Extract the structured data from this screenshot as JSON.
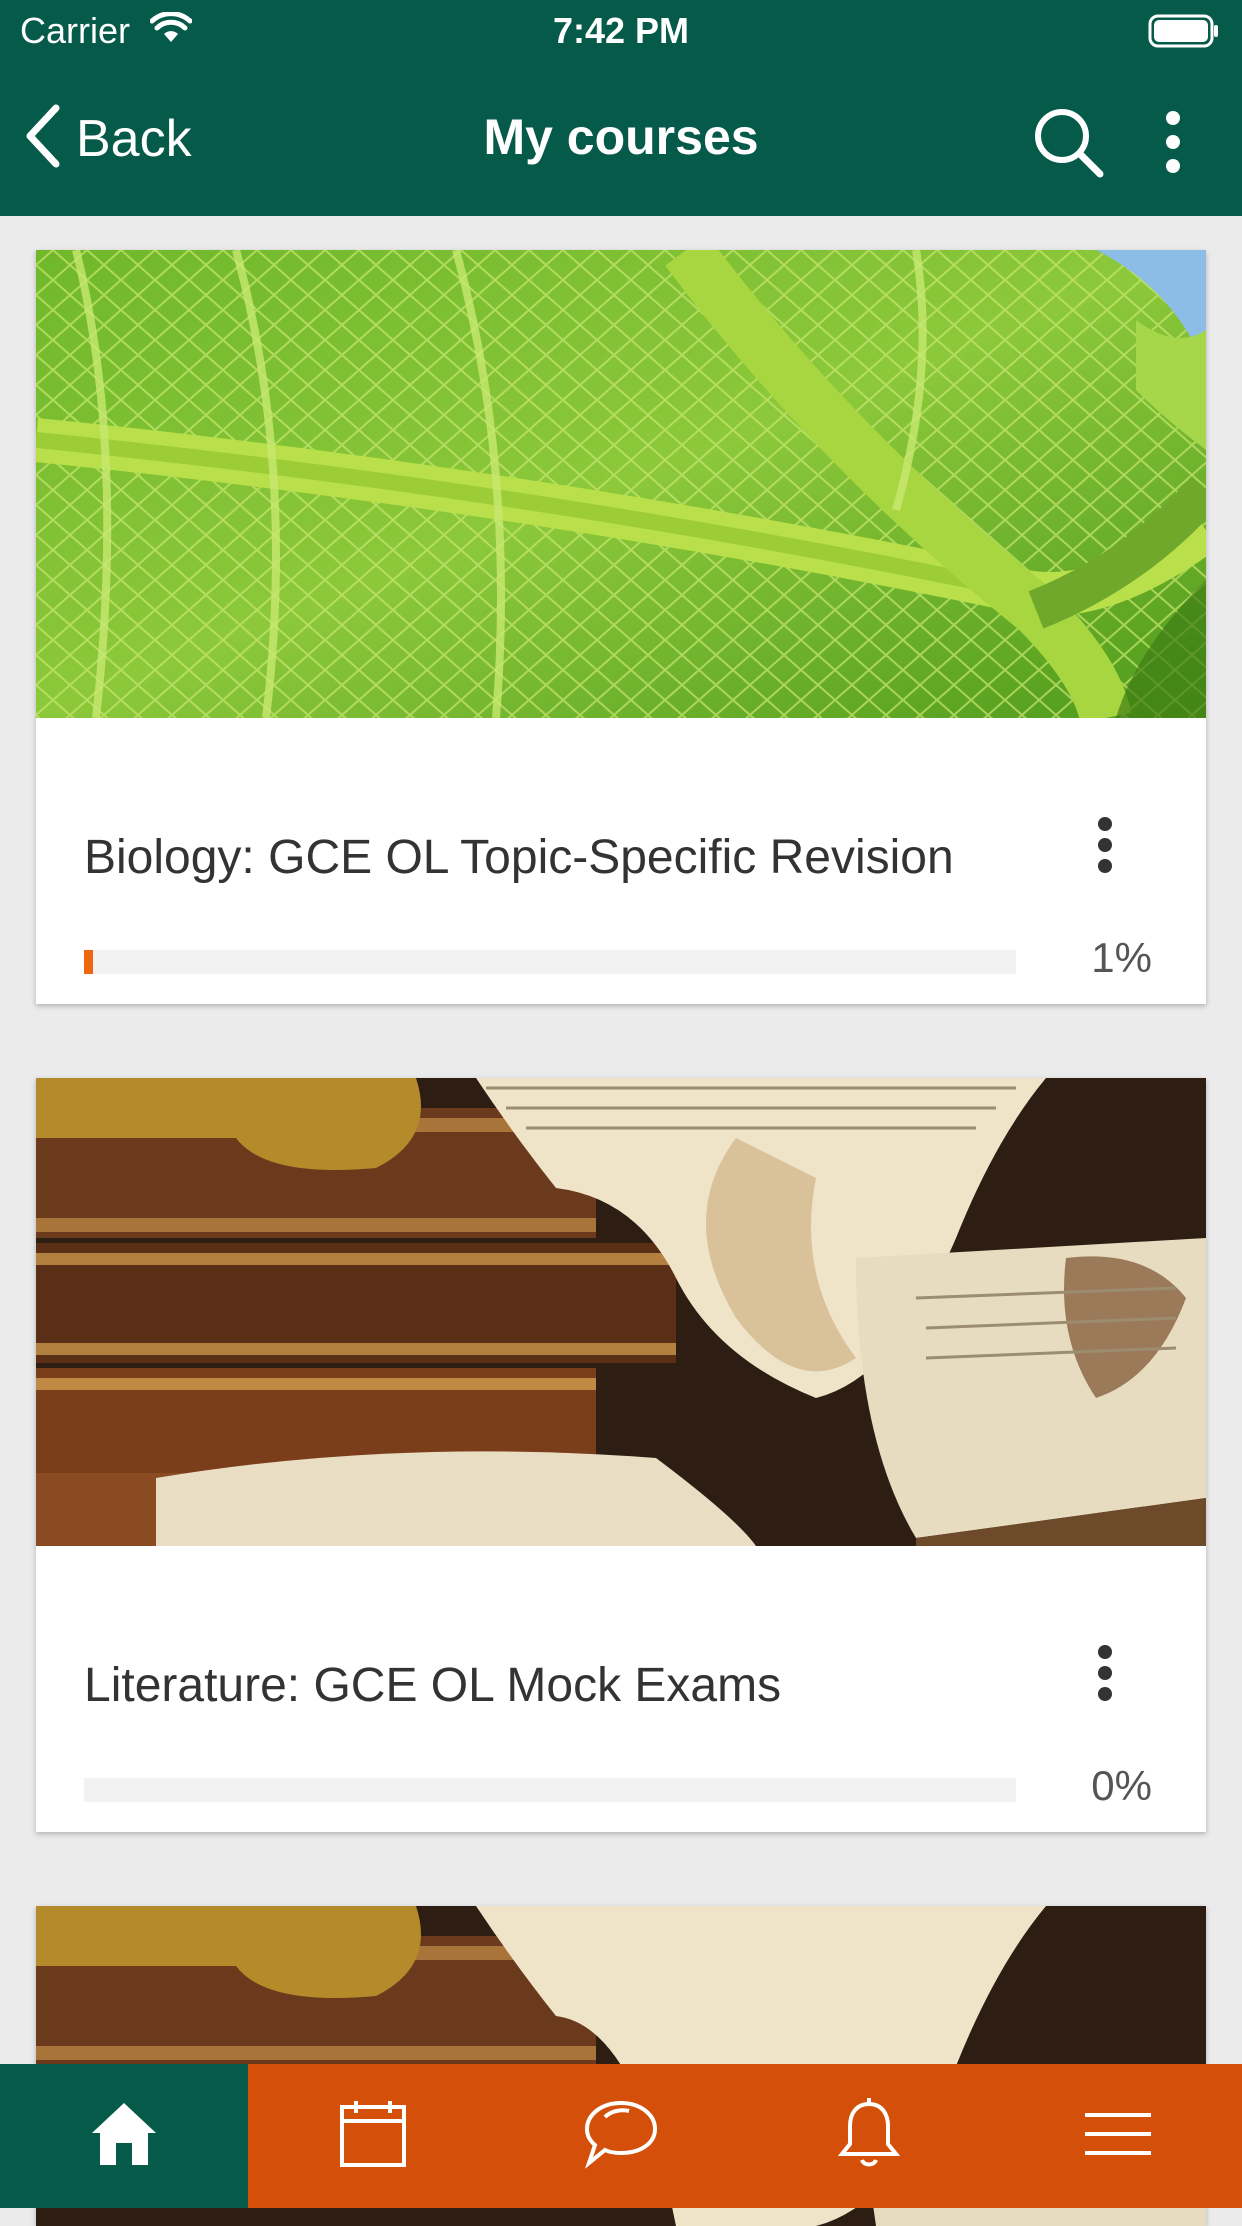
{
  "status_bar": {
    "carrier": "Carrier",
    "time": "7:42 PM"
  },
  "nav": {
    "back_label": "Back",
    "title": "My courses"
  },
  "courses": [
    {
      "name": "Biology: GCE OL Topic-Specific Revision",
      "progress": 1,
      "progress_label": "1%",
      "image": "leaf-photo"
    },
    {
      "name": "Literature: GCE OL Mock Exams",
      "progress": 0,
      "progress_label": "0%",
      "image": "old-books-photo"
    },
    {
      "name": "",
      "image": "old-books-photo"
    }
  ],
  "tabs": [
    {
      "icon": "home-icon",
      "active": true
    },
    {
      "icon": "calendar-icon",
      "active": false
    },
    {
      "icon": "chat-icon",
      "active": false
    },
    {
      "icon": "bell-icon",
      "active": false
    },
    {
      "icon": "menu-icon",
      "active": false
    }
  ],
  "colors": {
    "header": "#065a4a",
    "tabbar": "#d4500a",
    "progress": "#f0660e",
    "background": "#ebebeb"
  }
}
